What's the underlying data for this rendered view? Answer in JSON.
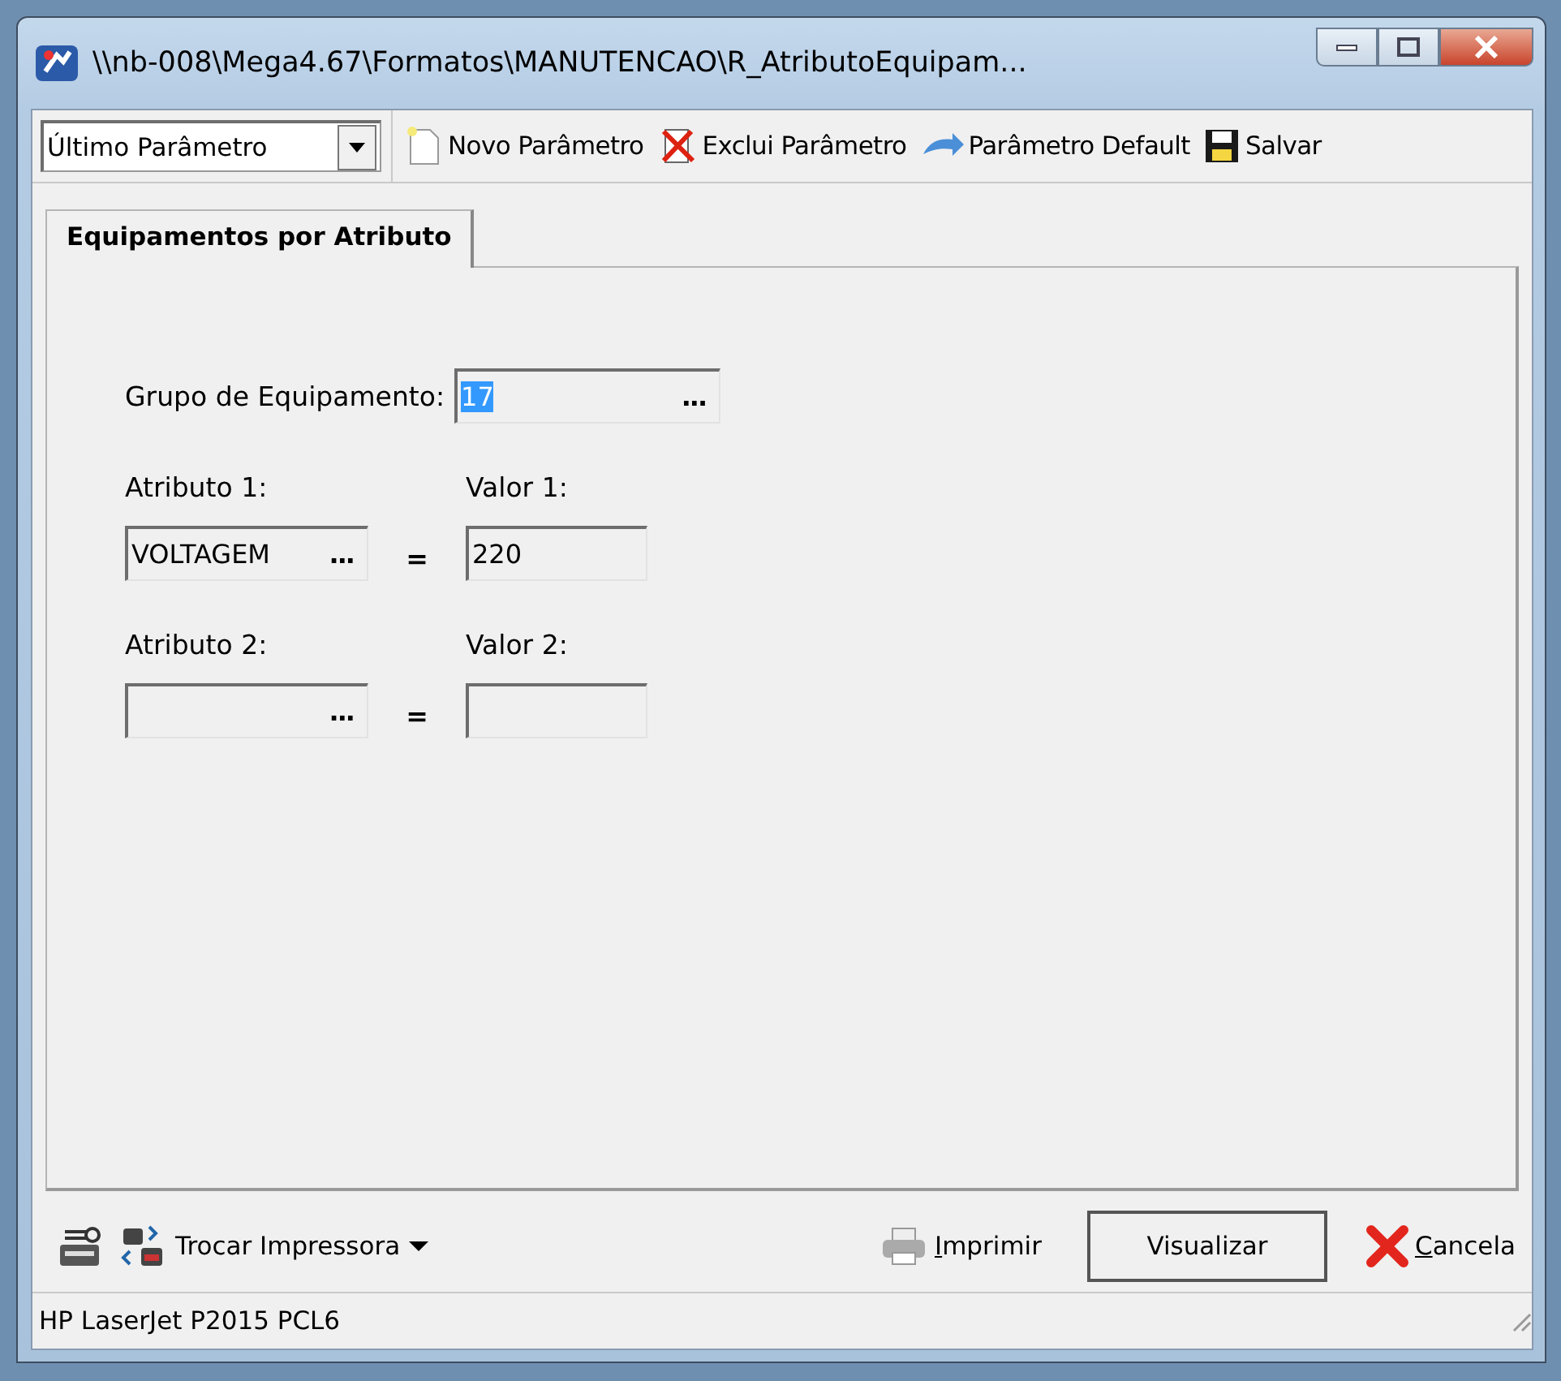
{
  "window": {
    "title": "\\\\nb-008\\Mega4.67\\Formatos\\MANUTENCAO\\R_AtributoEquipam..."
  },
  "toolbar": {
    "parameter_select": {
      "value": "Último Parâmetro"
    },
    "buttons": [
      {
        "kind": "new",
        "label": "Novo Parâmetro"
      },
      {
        "kind": "delete",
        "label": "Exclui Parâmetro"
      },
      {
        "kind": "default",
        "label": "Parâmetro Default"
      },
      {
        "kind": "save",
        "label": "Salvar"
      }
    ]
  },
  "tabs": [
    {
      "label": "Equipamentos por Atributo",
      "selected": true
    }
  ],
  "form": {
    "group": {
      "label": "Grupo de Equipamento:",
      "value": "17",
      "highlighted": true,
      "ellipsis": "..."
    },
    "rows": [
      {
        "attribute_label": "Atributo 1:",
        "attribute_value": "VOLTAGEM",
        "ellipsis": "...",
        "equals": "=",
        "value_label": "Valor 1:",
        "value": "220"
      },
      {
        "attribute_label": "Atributo 2:",
        "attribute_value": "",
        "ellipsis": "...",
        "equals": "=",
        "value_label": "Valor 2:",
        "value": ""
      }
    ]
  },
  "bottom": {
    "printer_change": "Trocar Impressora",
    "print": "Imprimir",
    "preview": "Visualizar",
    "cancel": "Cancela"
  },
  "status_bar": {
    "printer": "HP LaserJet P2015 PCL6"
  }
}
